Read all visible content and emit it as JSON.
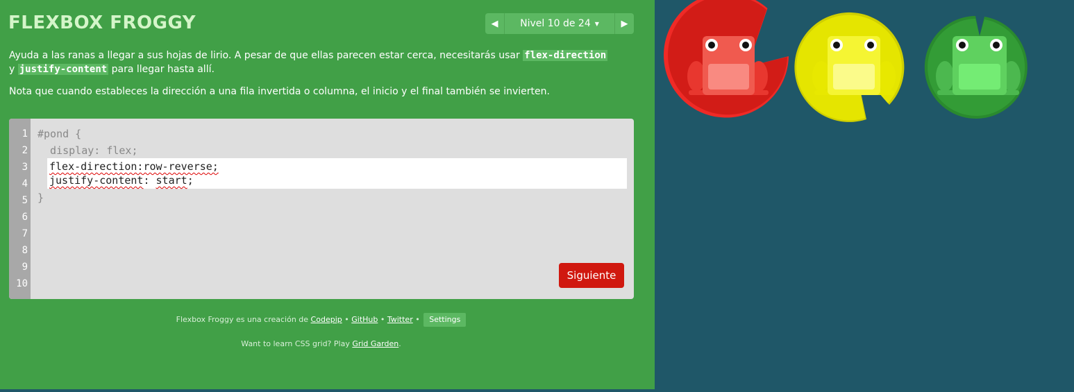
{
  "app": {
    "title": "FLEXBOX FROGGY"
  },
  "nav": {
    "prev_icon": "arrow-left-icon",
    "level_label": "Nivel 10 de 24",
    "caret_icon": "caret-down-icon",
    "next_icon": "arrow-right-icon"
  },
  "instructions": {
    "p1_a": "Ayuda a las ranas a llegar a sus hojas de lirio. A pesar de que ellas parecen estar cerca, necesitarás usar",
    "code1": "flex-direction",
    "p1_b": "y",
    "code2": "justify-content",
    "p1_c": "para llegar hasta allí.",
    "p2": "Nota que cuando estableces la dirección a una fila invertida o columna, el inicio y el final también se invierten."
  },
  "editor": {
    "line_numbers": [
      "1",
      "2",
      "3",
      "4",
      "5",
      "6",
      "7",
      "8",
      "9",
      "10"
    ],
    "line1": "#pond {",
    "line2": "  display: flex;",
    "input_line1": "flex-direction:row-reverse;",
    "input_line2_prop": "justify-content",
    "input_line2_sep": ": ",
    "input_line2_val": "start",
    "input_line2_end": ";",
    "line5": "}",
    "next_label": "Siguiente"
  },
  "footer": {
    "credit_text": "Flexbox Froggy es una creación de",
    "link_codepip": "Codepip",
    "sep1": "•",
    "link_github": "GitHub",
    "sep2": "•",
    "link_twitter": "Twitter",
    "sep3": "•",
    "settings_label": "Settings",
    "grid_text": "Want to learn CSS grid? Play",
    "grid_link": "Grid Garden",
    "grid_end": "."
  },
  "colors": {
    "left_bg": "#41a047",
    "pond_bg": "#1f5768",
    "red": "#d0180f",
    "yellow": "#e5e500",
    "green": "#2e8b30"
  },
  "pond": {
    "lilypads": [
      "red-lilypad",
      "yellow-lilypad",
      "green-lilypad"
    ],
    "frogs": [
      "red-frog",
      "yellow-frog",
      "green-frog"
    ]
  }
}
